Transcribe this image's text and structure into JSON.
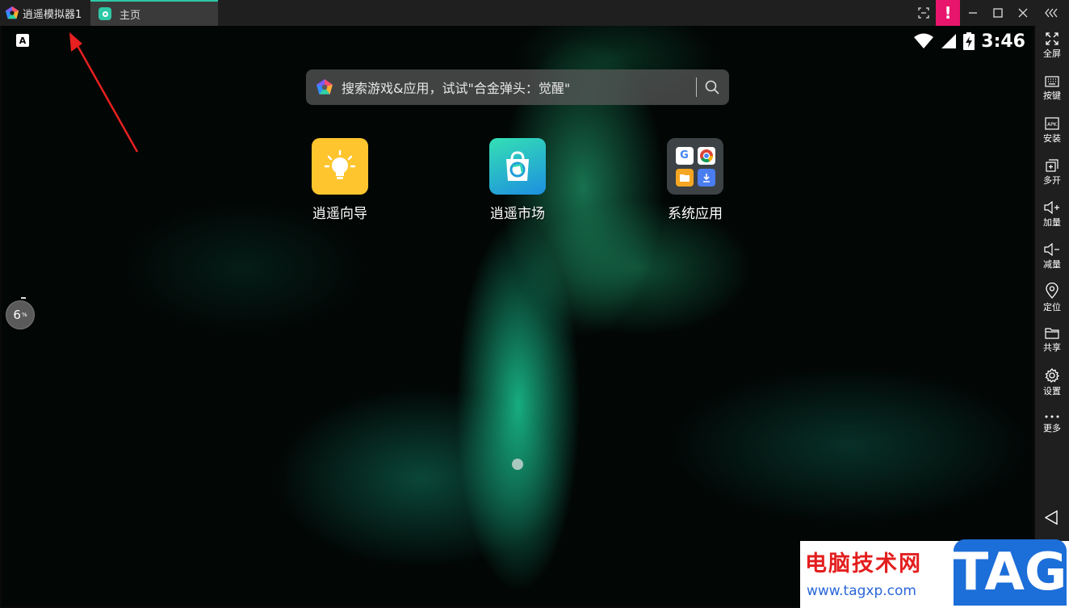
{
  "titlebar": {
    "app_title": "逍遥模拟器1",
    "home_tab": "主页"
  },
  "statusbar": {
    "keyboard_indicator": "A",
    "time": "3:46"
  },
  "search": {
    "placeholder": "搜索游戏&应用，试试\"合金弹头：觉醒\""
  },
  "apps": [
    {
      "label": "逍遥向导"
    },
    {
      "label": "逍遥市场"
    },
    {
      "label": "系统应用"
    }
  ],
  "sys_folder": {
    "google": "G"
  },
  "floating": {
    "percent": "6",
    "unit": "%"
  },
  "sidebar": {
    "items": [
      {
        "label": "全屏",
        "icon": "fullscreen-icon"
      },
      {
        "label": "按键",
        "icon": "keyboard-icon"
      },
      {
        "label": "安装",
        "icon": "apk-icon"
      },
      {
        "label": "多开",
        "icon": "multi-instance-icon"
      },
      {
        "label": "加量",
        "icon": "volume-up-icon"
      },
      {
        "label": "减量",
        "icon": "volume-down-icon"
      },
      {
        "label": "定位",
        "icon": "location-icon"
      },
      {
        "label": "共享",
        "icon": "folder-icon"
      },
      {
        "label": "设置",
        "icon": "gear-icon"
      },
      {
        "label": "更多",
        "icon": "more-icon"
      }
    ],
    "apk_text": "APK"
  },
  "watermark": {
    "title": "电脑技术网",
    "url": "www.tagxp.com",
    "badge": "TAG"
  },
  "colors": {
    "accent": "#2ec8a6",
    "alert": "#e8156c",
    "annotation": "#e82020",
    "watermark_red": "#e41e1e",
    "watermark_blue": "#1c6ed8"
  }
}
